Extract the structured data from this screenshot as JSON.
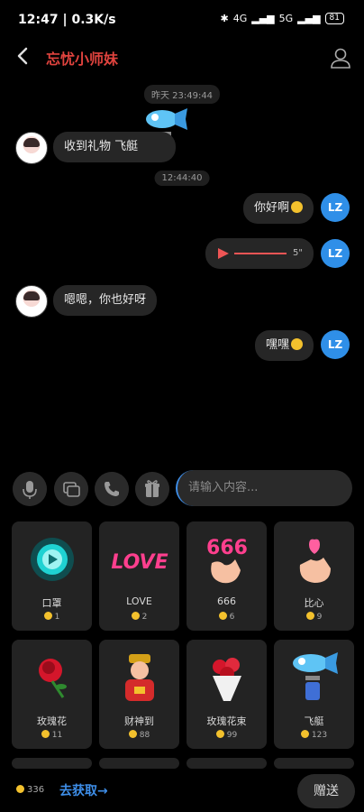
{
  "status_bar": {
    "time": "12:47",
    "speed": "0.3K/s",
    "network": "4G",
    "network2": "5G",
    "battery": "81"
  },
  "header": {
    "title": "忘忧小师妹"
  },
  "chat": {
    "timestamps": [
      "昨天 23:49:44",
      "12:44:40"
    ],
    "messages": [
      {
        "side": "left",
        "text": "收到礼物 飞艇"
      },
      {
        "side": "right",
        "text": "你好啊"
      },
      {
        "side": "right",
        "type": "voice",
        "duration": "5\""
      },
      {
        "side": "left",
        "text": "嗯嗯，你也好呀"
      },
      {
        "side": "right",
        "text": "嘿嘿"
      }
    ],
    "right_avatar_text": "LZ"
  },
  "input": {
    "placeholder": "请输入内容..."
  },
  "gifts": [
    {
      "name": "口罩",
      "price": "1"
    },
    {
      "name": "LOVE",
      "price": "2"
    },
    {
      "name": "666",
      "price": "6"
    },
    {
      "name": "比心",
      "price": "9"
    },
    {
      "name": "玫瑰花",
      "price": "11"
    },
    {
      "name": "财神到",
      "price": "88"
    },
    {
      "name": "玫瑰花束",
      "price": "99"
    },
    {
      "name": "飞艇",
      "price": "123"
    }
  ],
  "footer": {
    "balance": "336",
    "get_more": "去获取→",
    "send": "赠送"
  },
  "colors": {
    "accent": "#3e8ee8",
    "title": "#e0433e"
  }
}
